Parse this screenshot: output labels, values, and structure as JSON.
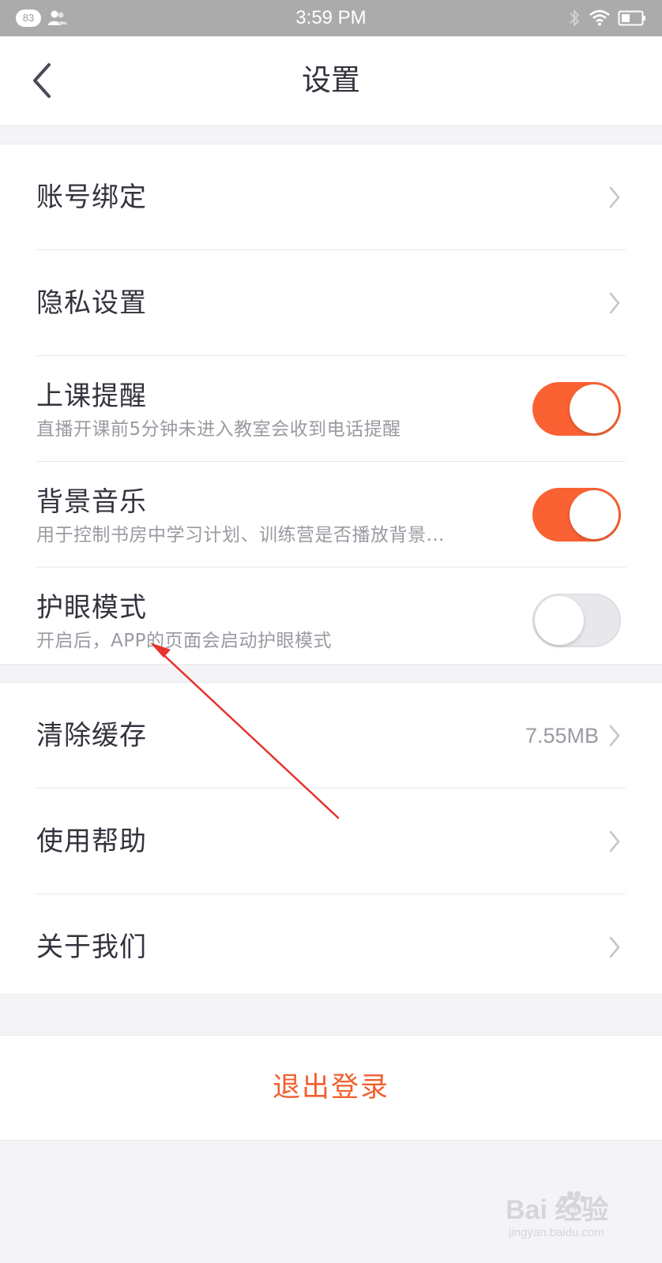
{
  "status_bar": {
    "notification_count": "83",
    "time": "3:59 PM",
    "icons": [
      "people-icon",
      "bluetooth-icon",
      "wifi-icon",
      "battery-icon"
    ]
  },
  "header": {
    "title": "设置",
    "back_icon": "chevron-left-icon"
  },
  "groups": {
    "account": {
      "binding": {
        "label": "账号绑定"
      },
      "privacy": {
        "label": "隐私设置"
      },
      "class_reminder": {
        "label": "上课提醒",
        "subtitle": "直播开课前5分钟未进入教室会收到电话提醒",
        "enabled": true
      },
      "background_music": {
        "label": "背景音乐",
        "subtitle": "用于控制书房中学习计划、训练营是否播放背景…",
        "enabled": true
      },
      "eye_care": {
        "label": "护眼模式",
        "subtitle": "开启后，APP的页面会启动护眼模式",
        "enabled": false
      }
    },
    "general": {
      "clear_cache": {
        "label": "清除缓存",
        "value": "7.55MB"
      },
      "help": {
        "label": "使用帮助"
      },
      "about": {
        "label": "关于我们"
      }
    }
  },
  "logout": {
    "label": "退出登录"
  },
  "colors": {
    "accent": "#fa6133",
    "logout_text": "#f25f2f",
    "annotation_arrow": "#e8322c",
    "status_bar": "#ababab",
    "page_background": "#f4f4f6"
  },
  "watermark": {
    "main": "Bai  经验",
    "sub": "jingyan.baidu.com"
  }
}
